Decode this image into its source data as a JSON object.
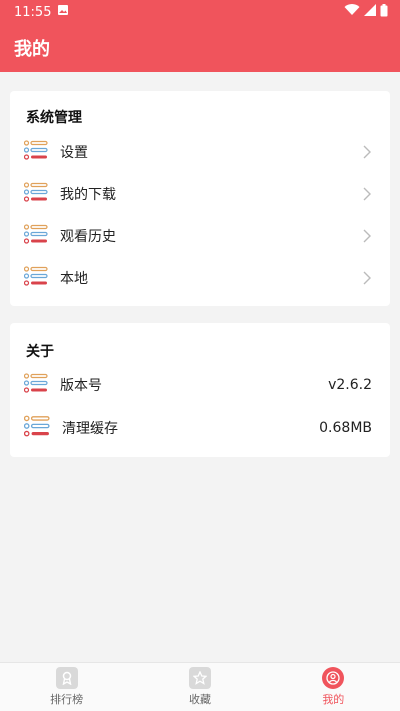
{
  "status_bar": {
    "time": "11:55"
  },
  "app_bar": {
    "title": "我的"
  },
  "section_system": {
    "title": "系统管理",
    "items": [
      {
        "label": "设置"
      },
      {
        "label": "我的下载"
      },
      {
        "label": "观看历史"
      },
      {
        "label": "本地"
      }
    ]
  },
  "section_about": {
    "title": "关于",
    "items": [
      {
        "label": "版本号",
        "value": "v2.6.2"
      },
      {
        "label": "清理缓存",
        "value": "0.68MB"
      }
    ]
  },
  "tab_bar": {
    "tabs": [
      {
        "label": "排行榜"
      },
      {
        "label": "收藏"
      },
      {
        "label": "我的"
      }
    ]
  },
  "colors": {
    "accent": "#f0545c",
    "background": "#f3f3f3"
  }
}
